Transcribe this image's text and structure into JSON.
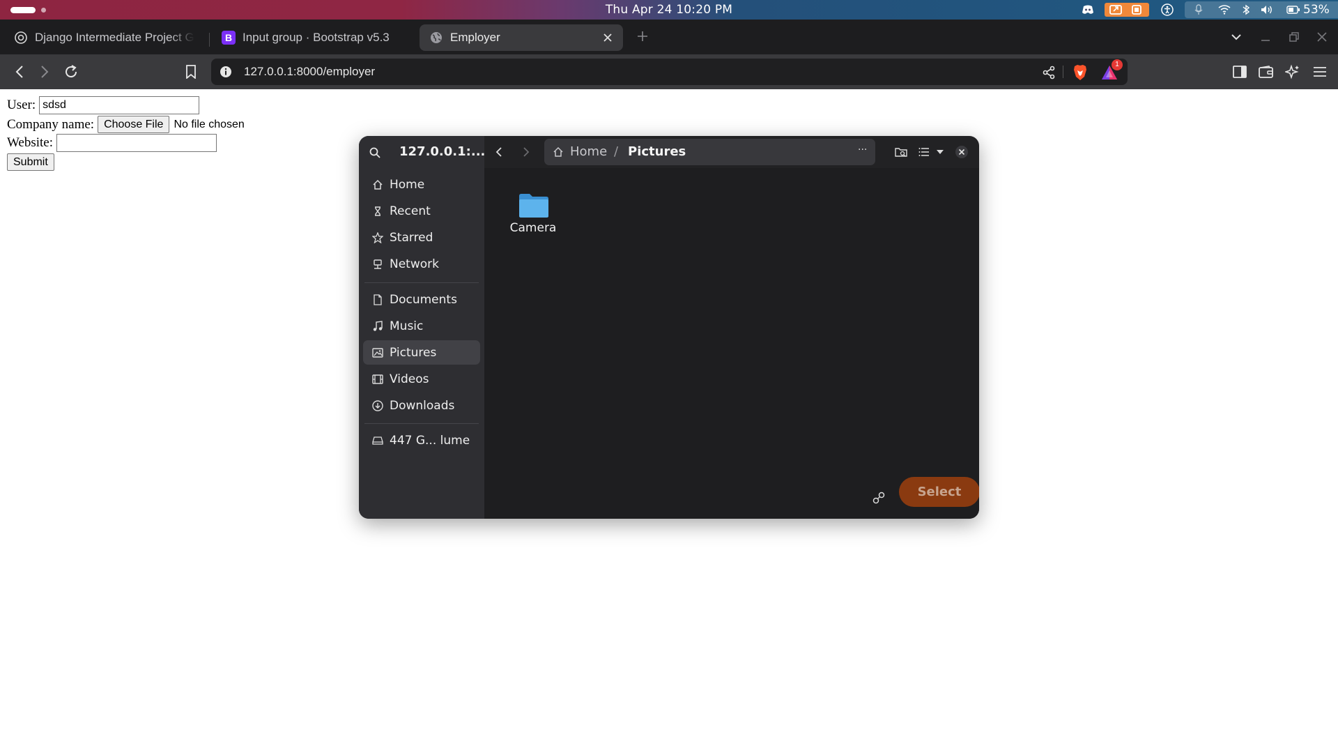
{
  "os": {
    "clock": "Thu Apr 24  10:20 PM",
    "battery": "53%",
    "accent_colors": {
      "bar_left": "#8e2541",
      "bar_right": "#1f5a82",
      "screenrec": "#f0883a"
    }
  },
  "browser": {
    "tabs": [
      {
        "label": "Django Intermediate Project G",
        "icon": "openai-icon"
      },
      {
        "label": "Input group · Bootstrap v5.3",
        "icon": "bootstrap-icon"
      },
      {
        "label": "Employer",
        "icon": "globe-icon",
        "active": true
      }
    ],
    "url": "127.0.0.1:8000/employer",
    "rewards_badge": "1"
  },
  "form": {
    "user_label": "User:",
    "user_value": "sdsd",
    "company_label": "Company name:",
    "choose_file_label": "Choose File",
    "no_file_text": "No file chosen",
    "website_label": "Website:",
    "website_value": "",
    "submit_label": "Submit"
  },
  "dialog": {
    "title": "127.0.0.1:...",
    "sidebar": {
      "places": [
        {
          "label": "Home",
          "icon": "home-icon"
        },
        {
          "label": "Recent",
          "icon": "recent-icon"
        },
        {
          "label": "Starred",
          "icon": "star-icon"
        },
        {
          "label": "Network",
          "icon": "network-icon"
        }
      ],
      "bookmarks": [
        {
          "label": "Documents",
          "icon": "document-icon"
        },
        {
          "label": "Music",
          "icon": "music-icon"
        },
        {
          "label": "Pictures",
          "icon": "pictures-icon",
          "active": true
        },
        {
          "label": "Videos",
          "icon": "video-icon"
        },
        {
          "label": "Downloads",
          "icon": "download-icon"
        }
      ],
      "volumes": [
        {
          "label": "447 G...  lume",
          "icon": "drive-icon"
        }
      ]
    },
    "path": {
      "home": "Home",
      "separator": "/",
      "current": "Pictures",
      "more": "···"
    },
    "files": [
      {
        "name": "Camera",
        "type": "folder"
      }
    ],
    "select_label": "Select",
    "colors": {
      "select_bg": "#8a3a10",
      "folder": "#5db3ec",
      "sidebar": "#2e2e32",
      "content": "#1e1e20"
    }
  }
}
